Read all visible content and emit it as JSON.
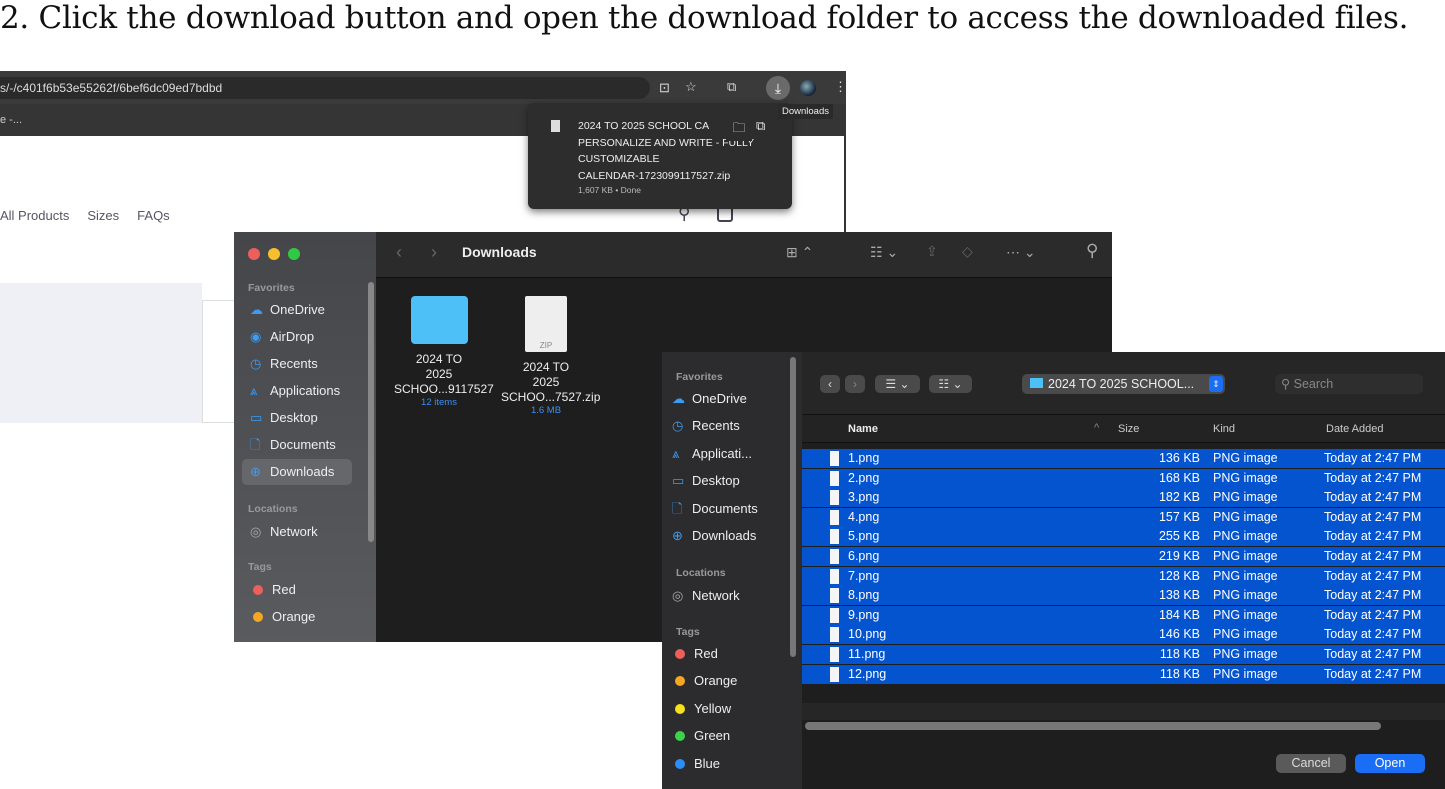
{
  "heading": "2. Click the download button and open the download folder to access the downloaded files.",
  "browser": {
    "url": "s/-/c401f6b53e55262f/6bef6dc09ed7bdbd",
    "bookmark": "e -...",
    "nav": [
      "All Products",
      "Sizes",
      "FAQs"
    ],
    "tooltip": "Downloads",
    "download": {
      "name_lines": [
        "2024 TO 2025 SCHOOL CA",
        "PERSONALIZE AND WRITE - FULLY",
        "CUSTOMIZABLE",
        "CALENDAR-1723099117527.zip"
      ],
      "status": "1,607 KB • Done"
    }
  },
  "finder": {
    "title": "Downloads",
    "favorites_label": "Favorites",
    "favorites": [
      "OneDrive",
      "AirDrop",
      "Recents",
      "Applications",
      "Desktop",
      "Documents",
      "Downloads"
    ],
    "locations_label": "Locations",
    "locations": [
      "Network"
    ],
    "tags_label": "Tags",
    "tags": [
      {
        "name": "Red",
        "color": "#ec5f5a"
      },
      {
        "name": "Orange",
        "color": "#f5a623"
      }
    ],
    "items": [
      {
        "line1": "2024 TO 2025",
        "line2": "SCHOO...9117527",
        "meta": "12 items"
      },
      {
        "line1": "2024 TO 2025",
        "line2": "SCHOO...7527.zip",
        "meta": "1.6 MB",
        "badge": "ZIP"
      }
    ]
  },
  "dialog": {
    "favorites_label": "Favorites",
    "favorites": [
      "OneDrive",
      "Recents",
      "Applicati...",
      "Desktop",
      "Documents",
      "Downloads"
    ],
    "locations_label": "Locations",
    "locations": [
      "Network"
    ],
    "tags_label": "Tags",
    "tags": [
      {
        "name": "Red",
        "color": "#ec5f5a"
      },
      {
        "name": "Orange",
        "color": "#f5a623"
      },
      {
        "name": "Yellow",
        "color": "#f7e01c"
      },
      {
        "name": "Green",
        "color": "#3cd24a"
      },
      {
        "name": "Blue",
        "color": "#2a8ef5"
      }
    ],
    "path": "2024 TO 2025 SCHOOL...",
    "search_placeholder": "Search",
    "columns": [
      "Name",
      "Size",
      "Kind",
      "Date Added"
    ],
    "files": [
      {
        "name": "1.png",
        "size": "136 KB",
        "kind": "PNG image",
        "date": "Today at 2:47 PM"
      },
      {
        "name": "2.png",
        "size": "168 KB",
        "kind": "PNG image",
        "date": "Today at 2:47 PM"
      },
      {
        "name": "3.png",
        "size": "182 KB",
        "kind": "PNG image",
        "date": "Today at 2:47 PM"
      },
      {
        "name": "4.png",
        "size": "157 KB",
        "kind": "PNG image",
        "date": "Today at 2:47 PM"
      },
      {
        "name": "5.png",
        "size": "255 KB",
        "kind": "PNG image",
        "date": "Today at 2:47 PM"
      },
      {
        "name": "6.png",
        "size": "219 KB",
        "kind": "PNG image",
        "date": "Today at 2:47 PM"
      },
      {
        "name": "7.png",
        "size": "128 KB",
        "kind": "PNG image",
        "date": "Today at 2:47 PM"
      },
      {
        "name": "8.png",
        "size": "138 KB",
        "kind": "PNG image",
        "date": "Today at 2:47 PM"
      },
      {
        "name": "9.png",
        "size": "184 KB",
        "kind": "PNG image",
        "date": "Today at 2:47 PM"
      },
      {
        "name": "10.png",
        "size": "146 KB",
        "kind": "PNG image",
        "date": "Today at 2:47 PM"
      },
      {
        "name": "11.png",
        "size": "118 KB",
        "kind": "PNG image",
        "date": "Today at 2:47 PM"
      },
      {
        "name": "12.png",
        "size": "118 KB",
        "kind": "PNG image",
        "date": "Today at 2:47 PM"
      }
    ],
    "cancel": "Cancel",
    "open": "Open",
    "selection_color": "#0453cf"
  }
}
